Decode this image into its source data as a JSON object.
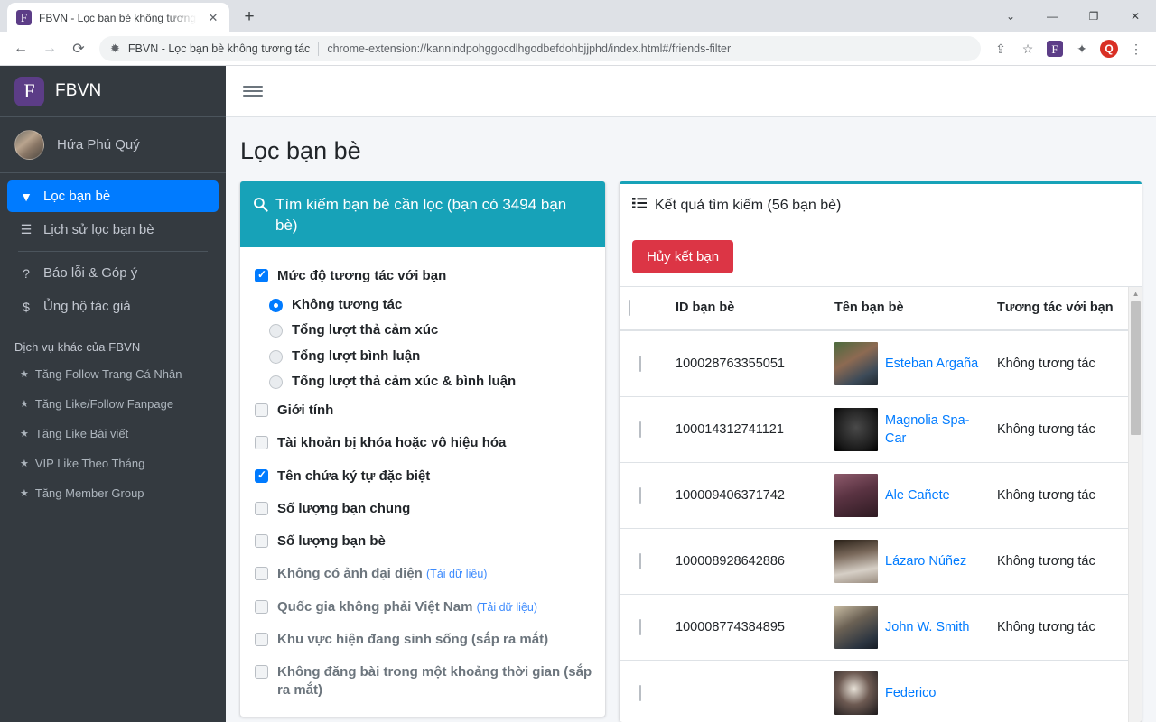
{
  "browser": {
    "tab": {
      "title": "FBVN - Lọc bạn bè không tương",
      "favicon_letter": "F",
      "close_icon": "✕"
    },
    "new_tab_icon": "+",
    "window_controls": {
      "minimize": "—",
      "maximize": "❐",
      "close": "✕",
      "chevron": "⌄"
    },
    "nav": {
      "back": "←",
      "forward": "→",
      "reload": "⟳"
    },
    "omnibox": {
      "extension_icon": "✹",
      "site_name": "FBVN - Lọc bạn bè không tương tác",
      "url": "chrome-extension://kannindpohggocdlhgodbefdohbjjphd/index.html#/friends-filter"
    },
    "toolbar_icons": {
      "share": "⇪",
      "bookmark": "☆",
      "extension_badge": "F",
      "puzzle": "✦",
      "profile": "Q",
      "menu": "⋮"
    }
  },
  "sidebar": {
    "brand": {
      "logo_letter": "F",
      "name": "FBVN"
    },
    "user": {
      "name": "Hứa Phú Quý"
    },
    "nav_items": [
      {
        "label": "Lọc bạn bè",
        "icon": "filter-icon",
        "glyph": "▼",
        "active": true
      },
      {
        "label": "Lịch sử lọc bạn bè",
        "icon": "list-icon",
        "glyph": "☰",
        "active": false
      },
      {
        "label": "Báo lỗi & Góp ý",
        "icon": "question-circle-icon",
        "glyph": "?",
        "active": false
      },
      {
        "label": "Ủng hộ tác giả",
        "icon": "donate-icon",
        "glyph": "$",
        "active": false
      }
    ],
    "services_heading": "Dịch vụ khác của FBVN",
    "services": [
      {
        "label": "Tăng Follow Trang Cá Nhân"
      },
      {
        "label": "Tăng Like/Follow Fanpage"
      },
      {
        "label": "Tăng Like Bài viết"
      },
      {
        "label": "VIP Like Theo Tháng"
      },
      {
        "label": "Tăng Member Group"
      }
    ],
    "star_glyph": "★"
  },
  "page": {
    "title": "Lọc bạn bè"
  },
  "filter_panel": {
    "header": "Tìm kiếm bạn bè cần lọc (bạn có 3494 bạn bè)",
    "search_glyph": "🔍",
    "options": [
      {
        "label": "Mức độ tương tác với bạn",
        "checked": true,
        "disabled": false
      },
      {
        "label": "Giới tính",
        "checked": false,
        "disabled": false
      },
      {
        "label": "Tài khoản bị khóa hoặc vô hiệu hóa",
        "checked": false,
        "disabled": false
      },
      {
        "label": "Tên chứa ký tự đặc biệt",
        "checked": true,
        "disabled": false
      },
      {
        "label": "Số lượng bạn chung",
        "checked": false,
        "disabled": false
      },
      {
        "label": "Số lượng bạn bè",
        "checked": false,
        "disabled": false
      },
      {
        "label": "Không có ảnh đại diện",
        "hint": "(Tải dữ liệu)",
        "checked": false,
        "disabled": true
      },
      {
        "label": "Quốc gia không phải Việt Nam",
        "hint": "(Tải dữ liệu)",
        "checked": false,
        "disabled": true
      },
      {
        "label": "Khu vực hiện đang sinh sống (sắp ra mắt)",
        "checked": false,
        "disabled": true
      },
      {
        "label": "Không đăng bài trong một khoảng thời gian (sắp ra mắt)",
        "checked": false,
        "disabled": true
      }
    ],
    "radios": [
      {
        "label": "Không tương tác",
        "selected": true
      },
      {
        "label": "Tổng lượt thả cảm xúc",
        "selected": false
      },
      {
        "label": "Tổng lượt bình luận",
        "selected": false
      },
      {
        "label": "Tổng lượt thả cảm xúc & bình luận",
        "selected": false
      }
    ]
  },
  "results_panel": {
    "header": "Kết quả tìm kiếm (56 bạn bè)",
    "list_glyph": "☰",
    "unfriend_button": "Hủy kết bạn",
    "columns": [
      "ID bạn bè",
      "Tên bạn bè",
      "Tương tác với bạn"
    ],
    "rows": [
      {
        "id": "100028763355051",
        "name": "Esteban Argaña",
        "interaction": "Không tương tác",
        "checked": false
      },
      {
        "id": "100014312741121",
        "name": "Magnolia Spa-Car",
        "interaction": "Không tương tác",
        "checked": false
      },
      {
        "id": "100009406371742",
        "name": "Ale Cañete",
        "interaction": "Không tương tác",
        "checked": false
      },
      {
        "id": "100008928642886",
        "name": "Lázaro Núñez",
        "interaction": "Không tương tác",
        "checked": false
      },
      {
        "id": "100008774384895",
        "name": "John W. Smith",
        "interaction": "Không tương tác",
        "checked": false
      },
      {
        "id": "",
        "name": "Federico",
        "interaction": "",
        "checked": false
      }
    ]
  },
  "colors": {
    "sidebar_bg": "#343a40",
    "accent_blue": "#007bff",
    "teal": "#17a2b8",
    "danger_red": "#dc3545",
    "link_blue": "#007bff",
    "brand_purple": "#5c3d87"
  }
}
